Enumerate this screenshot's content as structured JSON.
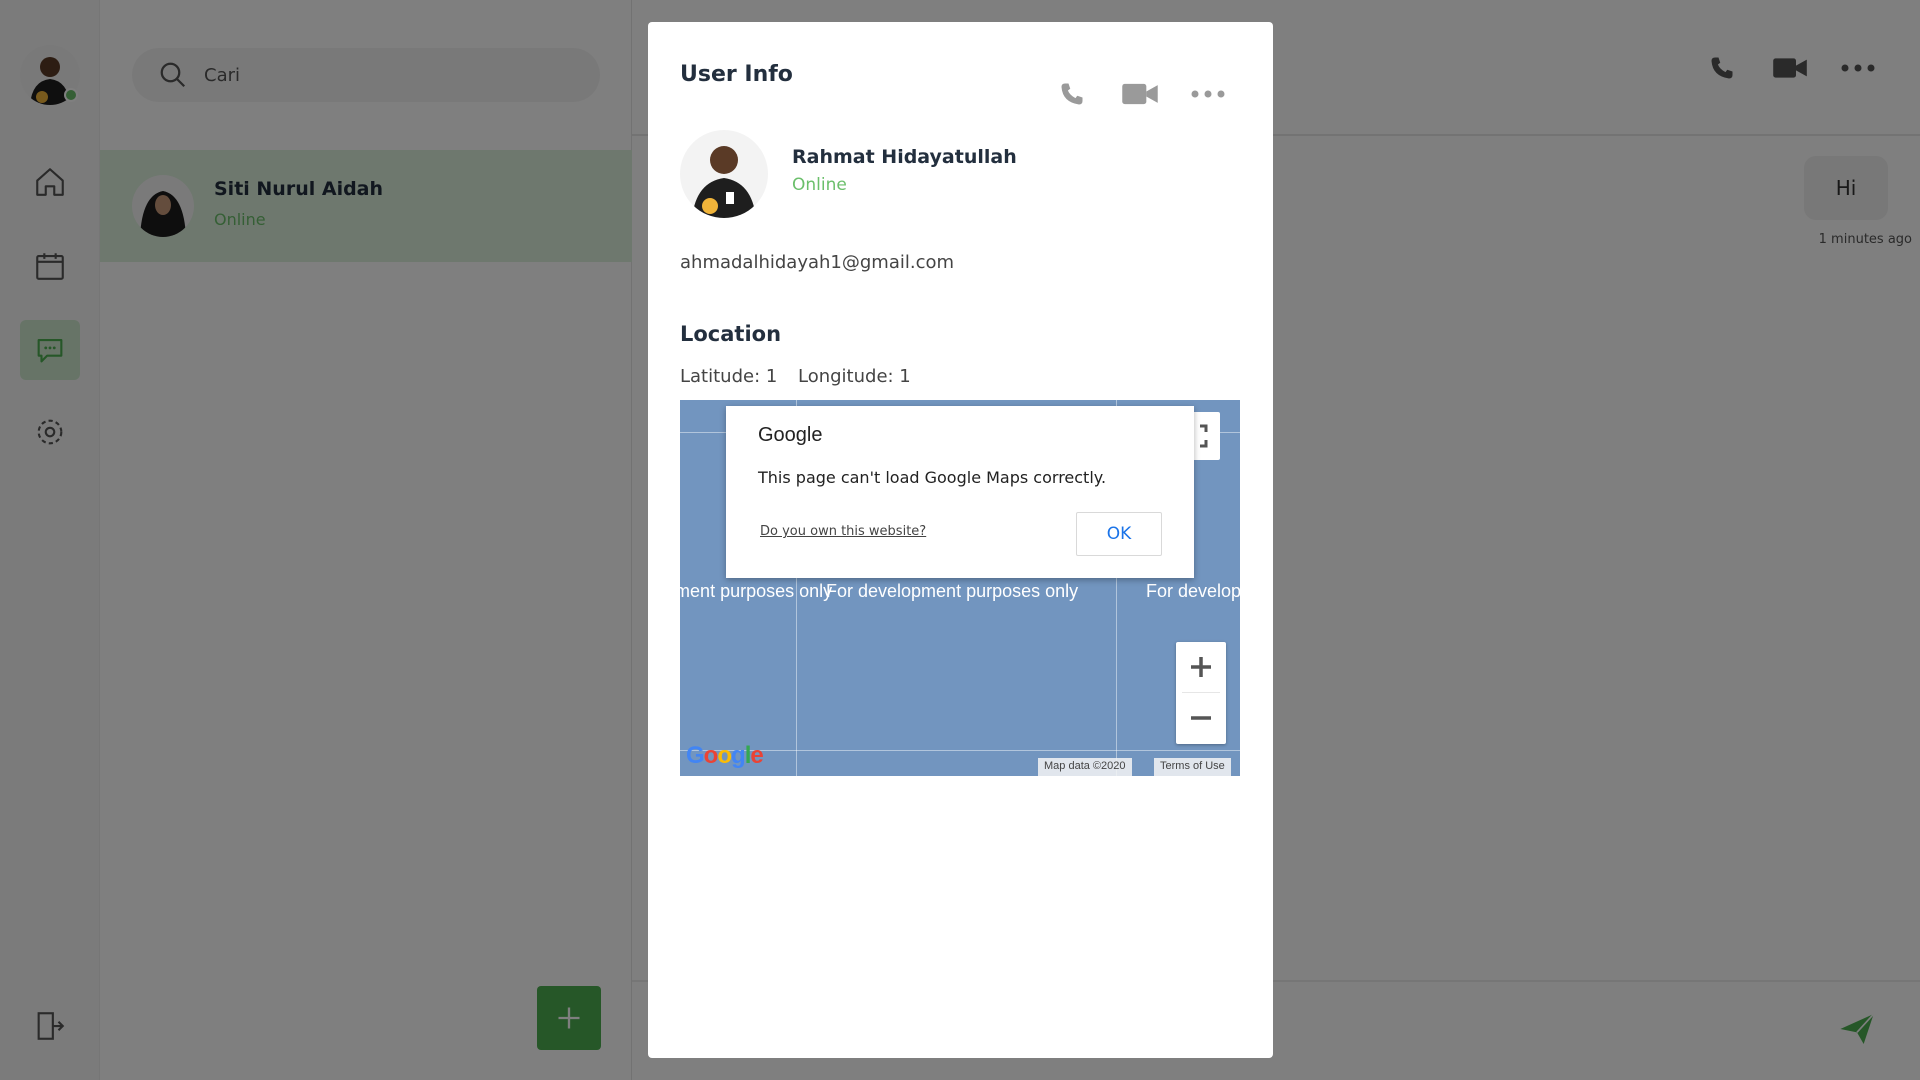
{
  "search": {
    "placeholder": "Cari"
  },
  "contacts": [
    {
      "name": "Siti Nurul Aidah",
      "status": "Online"
    }
  ],
  "chat": {
    "messages": [
      {
        "text": "Hi",
        "time": "1 minutes ago"
      }
    ]
  },
  "modal": {
    "title": "User Info",
    "user": {
      "name": "Rahmat Hidayatullah",
      "status": "Online",
      "email": "ahmadalhidayah1@gmail.com"
    },
    "location": {
      "title": "Location",
      "latitude_label": "Latitude: 1",
      "longitude_label": "Longitude: 1"
    },
    "map": {
      "watermark": "For development purposes only",
      "attribution": "Map data ©2020",
      "terms": "Terms of Use",
      "logo": "Google",
      "dialog": {
        "brand": "Google",
        "message": "This page can't load Google Maps correctly.",
        "link": "Do you own this website?",
        "ok": "OK"
      }
    }
  },
  "colors": {
    "accent": "#4caf50",
    "online": "#6bbf6b",
    "selected_row": "#ddf0dd",
    "text_dark": "#232f3e",
    "map_water": "#7295bf",
    "overlay": "rgba(0,0,0,0.5)"
  },
  "icons": {
    "rail": [
      "home-icon",
      "calendar-icon",
      "chat-icon",
      "gear-icon",
      "logout-icon"
    ],
    "header": [
      "phone-icon",
      "video-camera-icon",
      "more-icon"
    ],
    "search": "search-icon",
    "fab": "plus-icon",
    "send": "send-icon"
  }
}
